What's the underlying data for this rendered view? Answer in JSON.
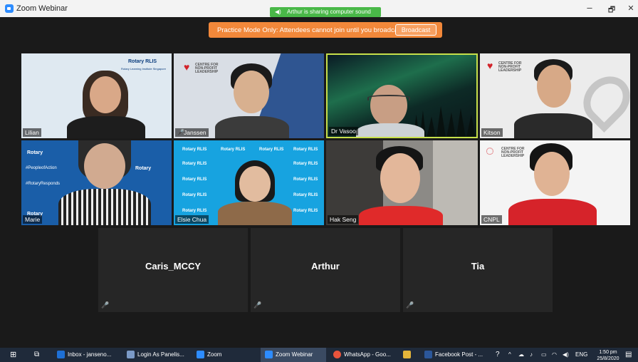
{
  "window": {
    "title": "Zoom Webinar",
    "sound_banner": "Arthur is sharing computer sound",
    "minimize": "–",
    "maximize": "🗗",
    "close": "✕"
  },
  "practice_banner": {
    "text": "Practice Mode Only: Attendees cannot join until you broadcast.",
    "button": "Broadcast"
  },
  "video_tiles": [
    {
      "name": "Lilian",
      "bg": "#dfe9f1",
      "muted": false,
      "logo": "Rotary RLIS",
      "logo_sub": "Rotary Learning Institute Singapore"
    },
    {
      "name": "Janssen",
      "bg": "#d9dee5",
      "muted": true,
      "logo": "CENTRE FOR NON-PROFIT LEADERSHIP"
    },
    {
      "name": "Dr Vasoo",
      "bg": "#0f2a22",
      "muted": false,
      "active_speaker": true
    },
    {
      "name": "Kitson",
      "bg": "#ececec",
      "muted": false,
      "logo": "CENTRE FOR NON-PROFIT LEADERSHIP"
    },
    {
      "name": "Marie",
      "bg": "#1a5ea8",
      "muted": false,
      "pattern": [
        "Rotary",
        "#PeopleofAction",
        "Rotary",
        "#RotaryResponds",
        "Rotary"
      ]
    },
    {
      "name": "Elsie Chua",
      "bg": "#17a3e0",
      "muted": false,
      "pattern": [
        "Rotary RLIS"
      ]
    },
    {
      "name": "Hak Seng",
      "bg": "#8c8a86",
      "muted": false
    },
    {
      "name": "CNPL",
      "bg": "#f4f4f4",
      "muted": false,
      "logo": "CENTRE FOR NON-PROFIT LEADERSHIP"
    }
  ],
  "audio_tiles": [
    {
      "name": "Caris_MCCY"
    },
    {
      "name": "Arthur"
    },
    {
      "name": "Tia"
    }
  ],
  "taskbar": {
    "items": [
      {
        "label": "Inbox - janseno...",
        "icon_color": "#1e70d6"
      },
      {
        "label": "Login As Panelis...",
        "icon_color": "#7b9ac7"
      },
      {
        "label": "Zoom",
        "icon_color": "#2d8cff"
      },
      {
        "label": "Zoom Webinar",
        "icon_color": "#2d8cff",
        "active": true
      },
      {
        "label": "WhatsApp - Goo...",
        "icon_color": "#e8543c"
      },
      {
        "label": "",
        "icon_color": "#e4b53a"
      },
      {
        "label": "Facebook Post - ...",
        "icon_color": "#2b579a"
      }
    ],
    "language": "ENG",
    "time": "1:50 pm",
    "date": "25/8/2020"
  }
}
